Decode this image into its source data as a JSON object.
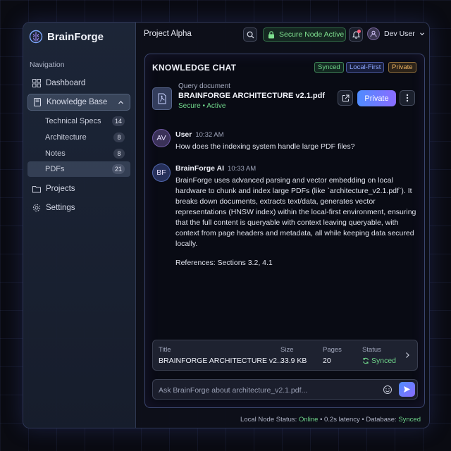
{
  "app": {
    "brand": "BrainForge"
  },
  "sidebar": {
    "heading": "Navigation",
    "items": [
      {
        "label": "Dashboard",
        "icon": "dashboard-icon"
      },
      {
        "label": "Knowledge Base",
        "icon": "book-icon",
        "expanded": true
      },
      {
        "label": "Projects",
        "icon": "folder-icon"
      },
      {
        "label": "Settings",
        "icon": "gear-icon"
      }
    ],
    "subitems": [
      {
        "label": "Technical Specs",
        "count": "14"
      },
      {
        "label": "Architecture",
        "count": "8"
      },
      {
        "label": "Notes",
        "count": "8"
      },
      {
        "label": "PDFs",
        "count": "21"
      }
    ]
  },
  "topbar": {
    "project": "Project Alpha",
    "secure_label": "Secure Node Active",
    "user": "Dev User"
  },
  "chat": {
    "title": "KNOWLEDGE CHAT",
    "tags": {
      "synced": "Synced",
      "local": "Local-First",
      "private": "Private"
    },
    "doc": {
      "label": "Query document",
      "name": "BRAINFORGE ARCHITECTURE v2.1.pdf",
      "status": "Secure • Active"
    },
    "private_button": "Private",
    "messages": [
      {
        "avatar": "AV",
        "name": "User",
        "time": "10:32 AM",
        "text": "How does the indexing system handle large PDF files?"
      },
      {
        "avatar": "BF",
        "name": "BrainForge AI",
        "time": "10:33 AM",
        "text": "BrainForge uses advanced parsing and vector embedding on local hardware to chunk and index large PDFs (like `architecture_v2.1.pdf`). It breaks down documents, extracts text/data, generates vector representations (HNSW index) within the local-first environment, ensuring that the full content is queryable with context leaving queryable, with context from page headers and metadata, all while keeping data secured locally.",
        "refs": "References: Sections 3.2, 4.1"
      }
    ],
    "file_card": {
      "title_head": "Title",
      "title": "BRAINFORGE ARCHITECTURE v2...",
      "size_head": "Size",
      "size": "33.9 KB",
      "pages_head": "Pages",
      "pages": "20",
      "status_head": "Status",
      "status": "Synced"
    },
    "input_placeholder": "Ask BrainForge about architecture_v2.1.pdf..."
  },
  "status_bar": {
    "node_label": "Local Node Status:",
    "node_value": "Online",
    "latency": "• 0.2s latency •",
    "db_label": "Database:",
    "db_value": "Synced"
  },
  "colors": {
    "accent": "#4f8cff",
    "accent2": "#8a6cff",
    "success": "#6fd48a",
    "warning": "#e8b060"
  }
}
